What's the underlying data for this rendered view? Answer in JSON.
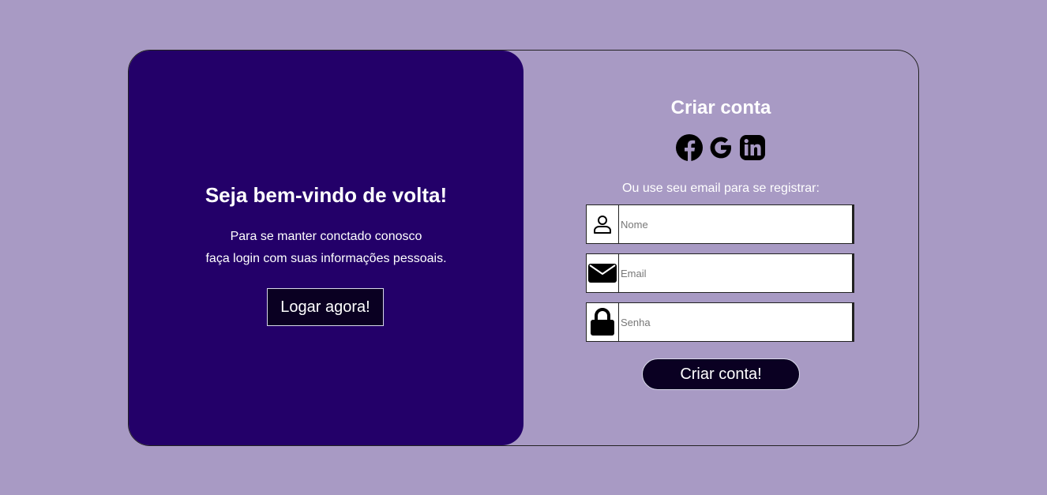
{
  "welcome": {
    "title": "Seja bem-vindo de volta!",
    "line1": "Para se manter conctado conosco",
    "line2": "faça login com suas informações pessoais.",
    "login_button": "Logar agora!"
  },
  "register": {
    "title": "Criar conta",
    "social": [
      {
        "icon": "facebook-icon"
      },
      {
        "icon": "google-icon"
      },
      {
        "icon": "linkedin-icon"
      }
    ],
    "alt_text": "Ou use seu email para se registrar:",
    "fields": {
      "name": {
        "placeholder": "Nome",
        "value": "",
        "icon": "person-icon"
      },
      "email": {
        "placeholder": "Email",
        "value": "",
        "icon": "envelope-icon"
      },
      "password": {
        "placeholder": "Senha",
        "value": "",
        "icon": "lock-icon"
      }
    },
    "submit_button": "Criar conta!"
  },
  "colors": {
    "background": "#a89ac4",
    "panel": "#230069",
    "button": "#0a0022"
  }
}
